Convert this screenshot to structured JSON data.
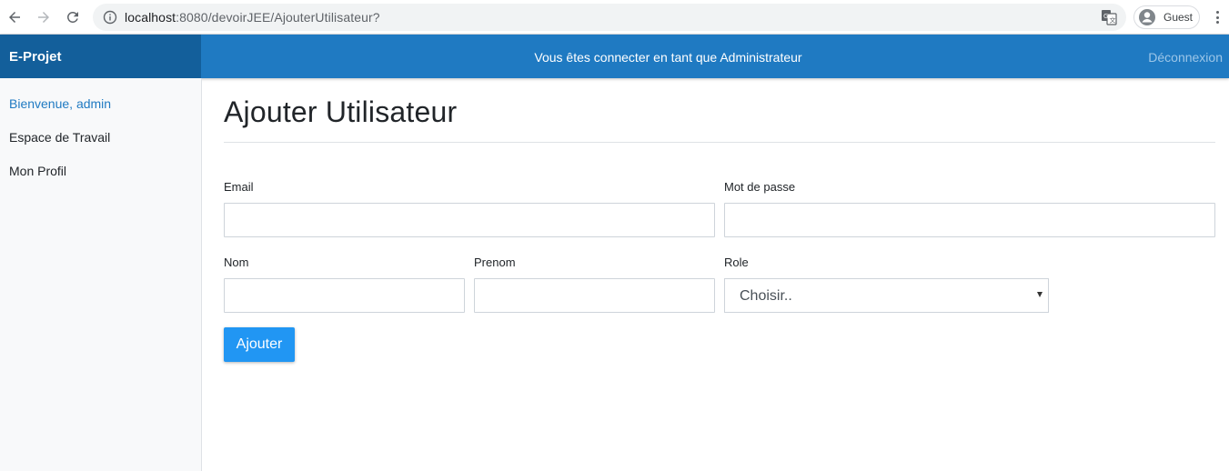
{
  "browser": {
    "url_host": "localhost",
    "url_rest": ":8080/devoirJEE/AjouterUtilisateur?",
    "profile_label": "Guest"
  },
  "navbar": {
    "brand": "E-Projet",
    "status_text": "Vous êtes connecter en tant que Administrateur",
    "logout_label": "Déconnexion"
  },
  "sidebar": {
    "items": [
      {
        "label": "Bienvenue, admin"
      },
      {
        "label": "Espace de Travail"
      },
      {
        "label": "Mon Profil"
      }
    ]
  },
  "main": {
    "title": "Ajouter Utilisateur",
    "form": {
      "email_label": "Email",
      "email_value": "",
      "password_label": "Mot de passe",
      "password_value": "",
      "nom_label": "Nom",
      "nom_value": "",
      "prenom_label": "Prenom",
      "prenom_value": "",
      "role_label": "Role",
      "role_selected": "Choisir..",
      "submit_label": "Ajouter"
    }
  },
  "colors": {
    "navbar": "#1f7ac2",
    "brand_bg": "#135f9b",
    "button": "#2196f3",
    "active_link": "#1f7ac2"
  }
}
